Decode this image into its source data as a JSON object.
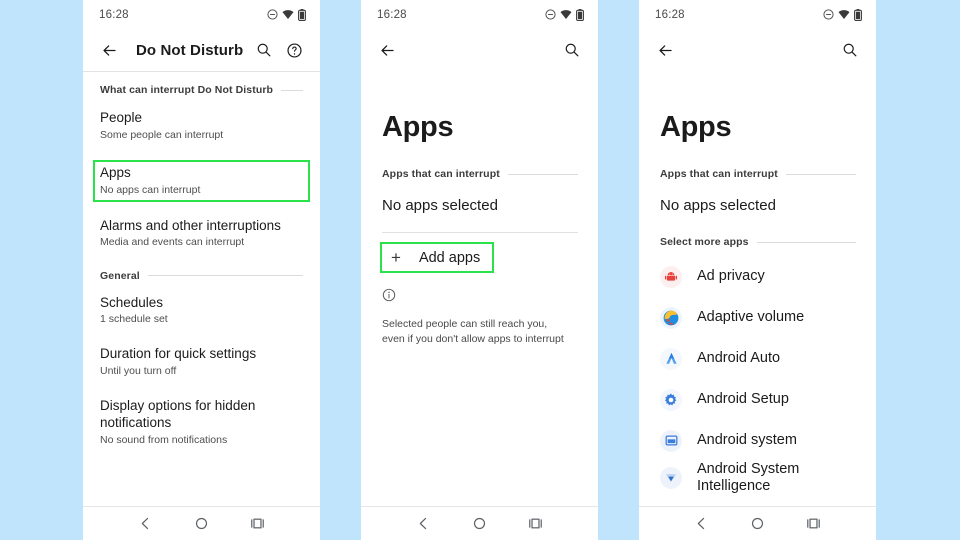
{
  "meta": {
    "background_color": "#bfe4fb",
    "highlight_color": "#2ae24a",
    "panel_background": "#ffffff"
  },
  "status_bar": {
    "time": "16:28",
    "icons": [
      "do-not-disturb-icon",
      "wifi-icon",
      "battery-icon"
    ]
  },
  "nav_bar": {
    "back": "back-nav-icon",
    "home": "home-nav-icon",
    "recents": "recents-nav-icon"
  },
  "panel1": {
    "appbar": {
      "back_icon": "back-arrow-icon",
      "title": "Do Not Disturb",
      "search_icon": "search-icon",
      "help_icon": "help-icon"
    },
    "section_label": "What can interrupt Do Not Disturb",
    "items": [
      {
        "title": "People",
        "subtitle": "Some people can interrupt",
        "highlighted": false
      },
      {
        "title": "Apps",
        "subtitle": "No apps can interrupt",
        "highlighted": true
      },
      {
        "title": "Alarms and other interruptions",
        "subtitle": "Media and events can interrupt",
        "highlighted": false
      }
    ],
    "section_label2": "General",
    "items2": [
      {
        "title": "Schedules",
        "subtitle": "1 schedule set"
      },
      {
        "title": "Duration for quick settings",
        "subtitle": "Until you turn off"
      },
      {
        "title": "Display options for hidden notifications",
        "subtitle": "No sound from notifications"
      }
    ]
  },
  "panel2": {
    "appbar": {
      "back_icon": "back-arrow-icon",
      "search_icon": "search-icon"
    },
    "title": "Apps",
    "section_label": "Apps that can interrupt",
    "empty_state": "No apps selected",
    "add_button": {
      "plus": "+",
      "label": "Add apps"
    },
    "info_icon": "info-icon",
    "info_text": "Selected people can still reach you, even if you don't allow apps to interrupt"
  },
  "panel3": {
    "appbar": {
      "back_icon": "back-arrow-icon",
      "search_icon": "search-icon"
    },
    "title": "Apps",
    "section_label": "Apps that can interrupt",
    "empty_state": "No apps selected",
    "section_label2": "Select more apps",
    "apps": [
      {
        "name": "Ad privacy",
        "icon": "ad-privacy-icon"
      },
      {
        "name": "Adaptive volume",
        "icon": "adaptive-volume-icon"
      },
      {
        "name": "Android Auto",
        "icon": "android-auto-icon"
      },
      {
        "name": "Android Setup",
        "icon": "android-setup-icon"
      },
      {
        "name": "Android system",
        "icon": "android-system-icon"
      },
      {
        "name": "Android System Intelligence",
        "icon": "android-system-intelligence-icon"
      }
    ]
  }
}
